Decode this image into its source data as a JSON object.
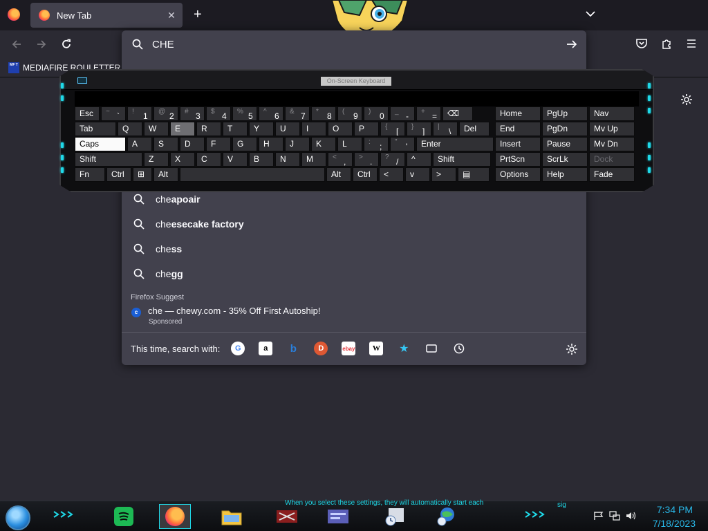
{
  "tabs": [
    {
      "title": "New Tab"
    }
  ],
  "urlbar": {
    "value": "CHE"
  },
  "bookmarks": [
    {
      "label": "MEDIAFIRE ROULETTER",
      "fav": "MF T"
    }
  ],
  "suggestions": [
    {
      "prefix": "che",
      "suffix": "apoair"
    },
    {
      "prefix": "che",
      "suffix": "esecake factory"
    },
    {
      "prefix": "che",
      "suffix": "ss"
    },
    {
      "prefix": "che",
      "suffix": "gg"
    }
  ],
  "firefox_suggest": {
    "label": "Firefox Suggest",
    "text": "che — chewy.com - 35% Off First Autoship!",
    "sub": "Sponsored"
  },
  "search_with": {
    "label": "This time, search with:",
    "engines": [
      {
        "name": "google",
        "glyph": "G",
        "color": "#4285f4"
      },
      {
        "name": "amazon",
        "glyph": "a",
        "color": "#000000"
      },
      {
        "name": "bing",
        "glyph": "b",
        "color": "#2a7fdb"
      },
      {
        "name": "duckduckgo",
        "glyph": "D",
        "color": "#de5833"
      },
      {
        "name": "ebay",
        "glyph": "e",
        "color": "#e53238"
      },
      {
        "name": "wikipedia",
        "glyph": "W",
        "color": "#000000"
      },
      {
        "name": "bookmarks",
        "glyph": "★",
        "color": "#35c6f4"
      },
      {
        "name": "tabs",
        "glyph": "▭",
        "color": "#fbfbfe"
      },
      {
        "name": "history",
        "glyph": "◷",
        "color": "#fbfbfe"
      }
    ]
  },
  "osk": {
    "title": "On-Screen Keyboard",
    "rows": [
      [
        {
          "label": "Esc"
        },
        {
          "shift": "~",
          "main": "`"
        },
        {
          "shift": "!",
          "main": "1"
        },
        {
          "shift": "@",
          "main": "2"
        },
        {
          "shift": "#",
          "main": "3"
        },
        {
          "shift": "$",
          "main": "4"
        },
        {
          "shift": "%",
          "main": "5"
        },
        {
          "shift": "^",
          "main": "6"
        },
        {
          "shift": "&",
          "main": "7"
        },
        {
          "shift": "*",
          "main": "8"
        },
        {
          "shift": "(",
          "main": "9"
        },
        {
          "shift": ")",
          "main": "0"
        },
        {
          "shift": "_",
          "main": "-"
        },
        {
          "shift": "+",
          "main": "="
        },
        {
          "label": "⌫"
        }
      ],
      [
        {
          "label": "Tab"
        },
        {
          "label": "Q"
        },
        {
          "label": "W"
        },
        {
          "label": "E"
        },
        {
          "label": "R"
        },
        {
          "label": "T"
        },
        {
          "label": "Y"
        },
        {
          "label": "U"
        },
        {
          "label": "I"
        },
        {
          "label": "O"
        },
        {
          "label": "P"
        },
        {
          "shift": "{",
          "main": "["
        },
        {
          "shift": "}",
          "main": "]"
        },
        {
          "shift": "|",
          "main": "\\"
        },
        {
          "label": "Del"
        }
      ],
      [
        {
          "label": "Caps"
        },
        {
          "label": "A"
        },
        {
          "label": "S"
        },
        {
          "label": "D"
        },
        {
          "label": "F"
        },
        {
          "label": "G"
        },
        {
          "label": "H"
        },
        {
          "label": "J"
        },
        {
          "label": "K"
        },
        {
          "label": "L"
        },
        {
          "shift": ":",
          "main": ";"
        },
        {
          "shift": "\"",
          "main": "'"
        },
        {
          "label": "Enter"
        }
      ],
      [
        {
          "label": "Shift"
        },
        {
          "label": "Z"
        },
        {
          "label": "X"
        },
        {
          "label": "C"
        },
        {
          "label": "V"
        },
        {
          "label": "B"
        },
        {
          "label": "N"
        },
        {
          "label": "M"
        },
        {
          "shift": "<",
          "main": ","
        },
        {
          "shift": ">",
          "main": "."
        },
        {
          "shift": "?",
          "main": "/"
        },
        {
          "label": "^"
        },
        {
          "label": "Shift"
        }
      ],
      [
        {
          "label": "Fn"
        },
        {
          "label": "Ctrl"
        },
        {
          "label": "⊞"
        },
        {
          "label": "Alt"
        },
        {
          "label": ""
        },
        {
          "label": "Alt"
        },
        {
          "label": "Ctrl"
        },
        {
          "label": "<"
        },
        {
          "label": "v"
        },
        {
          "label": ">"
        },
        {
          "label": "▤"
        }
      ]
    ],
    "nav_keys": [
      [
        "Home",
        "PgUp",
        "Nav"
      ],
      [
        "End",
        "PgDn",
        "Mv Up"
      ],
      [
        "Insert",
        "Pause",
        "Mv Dn"
      ],
      [
        "PrtScn",
        "ScrLk",
        "Dock"
      ],
      [
        "Options",
        "Help",
        "Fade"
      ]
    ]
  },
  "taskbar": {
    "notice": "When you select these settings, they will automatically start each",
    "tray_label": "sig",
    "time": "7:34 PM",
    "date": "7/18/2023"
  }
}
